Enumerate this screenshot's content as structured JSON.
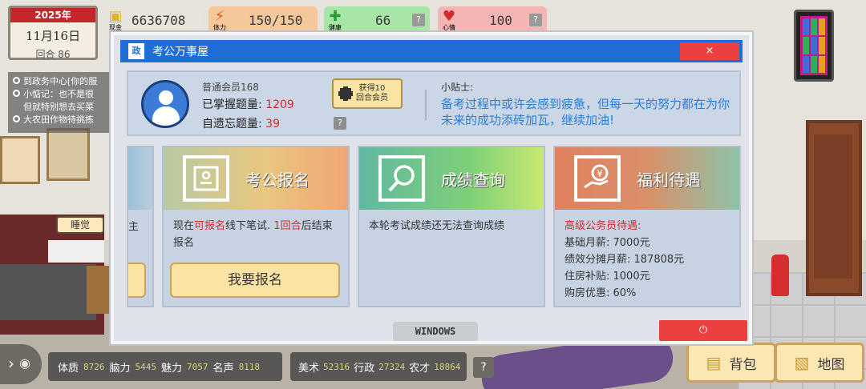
{
  "hud": {
    "date": {
      "year": "2025年",
      "day": "11月16日",
      "turn": "回合 86"
    },
    "cash": {
      "label": "现金",
      "value": "6636708",
      "color": "#f3d36b"
    },
    "stamina": {
      "label": "体力",
      "value": "150/150",
      "color": "#f4c89a"
    },
    "health": {
      "label": "健康",
      "value": "66",
      "color": "#a8e6a8"
    },
    "mood": {
      "label": "心情",
      "value": "100",
      "color": "#f4b5b5"
    },
    "help_q": "?"
  },
  "notes": [
    "到政务中心[你的服",
    "小惦记：也不是很",
    "但就特别想去买菜",
    "大农田作物待挑拣"
  ],
  "sleep_button": "睡觉",
  "dialog": {
    "title": "考公万事屋",
    "logo_text": "政",
    "close": "×",
    "member": {
      "level": "普通会员168",
      "mastered_label": "已掌握题量:",
      "mastered_value": "1209",
      "forgot_label": "自遗忘题量:",
      "forgot_value": "39",
      "get_member_button": "获得10\n回合会员",
      "help_q": "?"
    },
    "tip": {
      "title": "小贴士:",
      "text": "备考过程中或许会感到疲惫，但每一天的努力都在为你未来的成功添砖加瓦，继续加油!"
    },
    "partial_card": {
      "text": "主"
    },
    "cards": [
      {
        "title": "考公报名",
        "body_prefix": "现在",
        "body_highlight1": "可报名",
        "body_middle": "线下笔试. ",
        "body_highlight2": "1回合",
        "body_suffix": "后结束报名",
        "button": "我要报名"
      },
      {
        "title": "成绩查询",
        "body": "本轮考试成绩还无法查询成绩"
      },
      {
        "title": "福利待遇",
        "heading": "高级公务员待遇:",
        "lines": [
          "基础月薪: 7000元",
          "绩效分摊月薪: 187808元",
          "住房补贴: 1000元",
          "购房优惠: 60%"
        ]
      }
    ],
    "windows_button": "WINDOWS",
    "power_button": "⏻"
  },
  "attributes": [
    {
      "name": "体质",
      "value": "8726"
    },
    {
      "name": "脑力",
      "value": "5445"
    },
    {
      "name": "魅力",
      "value": "7057"
    },
    {
      "name": "名声",
      "value": "8118"
    }
  ],
  "attributes2": [
    {
      "name": "美术",
      "value": "52316"
    },
    {
      "name": "行政",
      "value": "27324"
    },
    {
      "name": "农才",
      "value": "18864"
    }
  ],
  "attr_help": "?",
  "bag_button": "背包",
  "map_button": "地图"
}
